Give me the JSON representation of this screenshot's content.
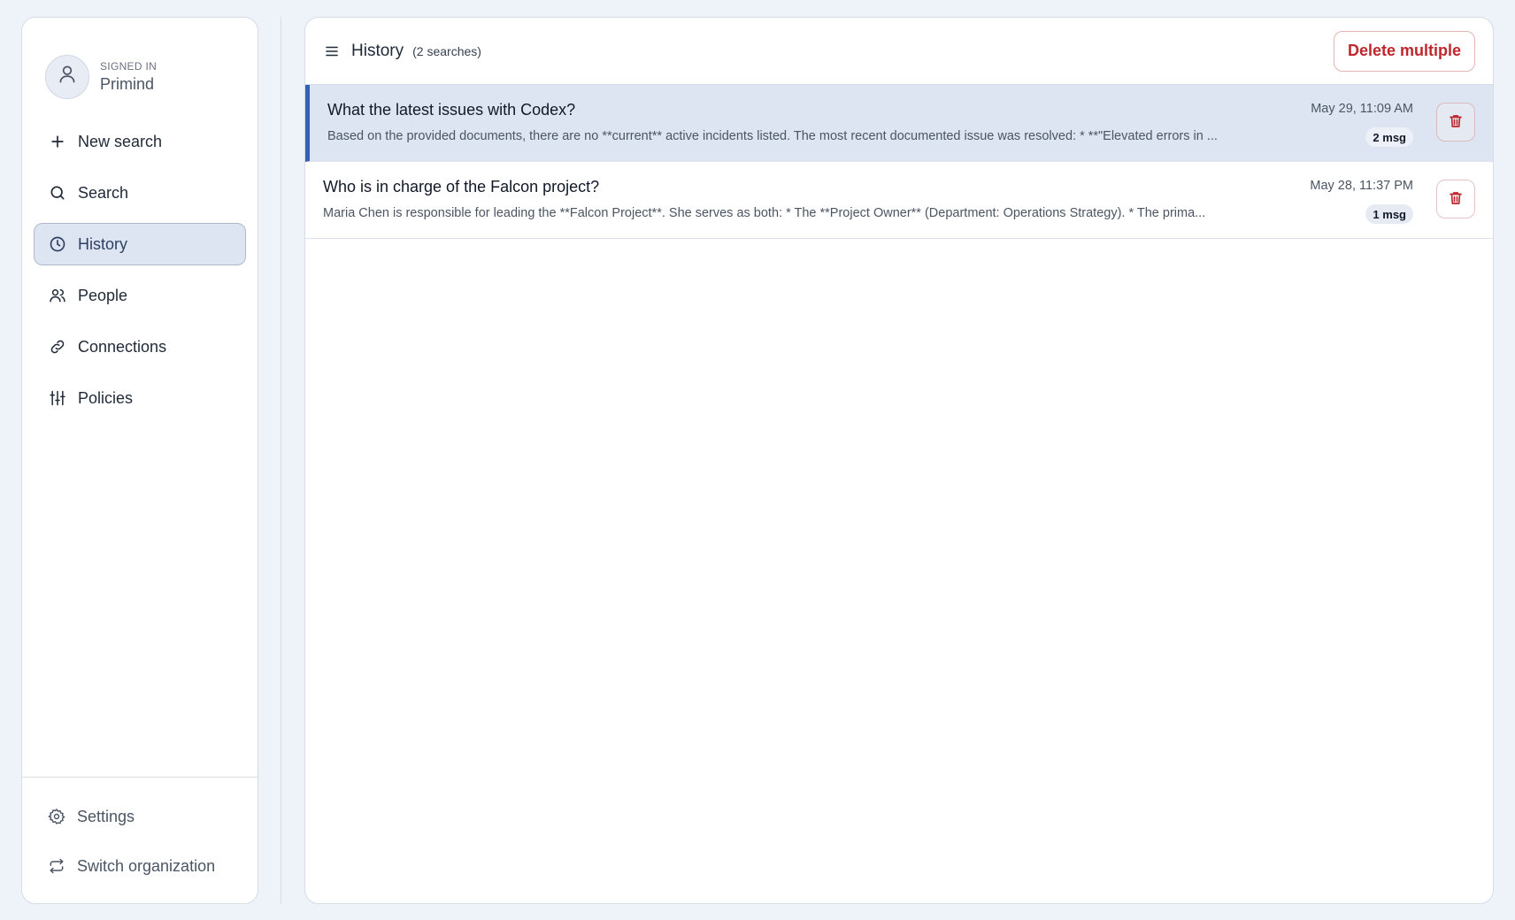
{
  "user": {
    "status": "SIGNED IN",
    "name": "Primind",
    "avatar_icon": "user-icon"
  },
  "sidebar": {
    "items": [
      {
        "label": "New search",
        "icon": "plus-icon",
        "active": false
      },
      {
        "label": "Search",
        "icon": "search-icon",
        "active": false
      },
      {
        "label": "History",
        "icon": "clock-icon",
        "active": true
      },
      {
        "label": "People",
        "icon": "people-icon",
        "active": false
      },
      {
        "label": "Connections",
        "icon": "link-icon",
        "active": false
      },
      {
        "label": "Policies",
        "icon": "sliders-icon",
        "active": false
      }
    ],
    "bottom": [
      {
        "label": "Settings",
        "icon": "gear-icon"
      },
      {
        "label": "Switch organization",
        "icon": "switch-icon"
      }
    ]
  },
  "header": {
    "title": "History",
    "count": "(2 searches)",
    "delete_multiple_label": "Delete multiple"
  },
  "history": [
    {
      "title": "What the latest issues with Codex?",
      "snippet": "Based on the provided documents, there are no **current** active incidents listed. The most recent documented issue was resolved: * **\"Elevated errors in ...",
      "date": "May 29, 11:09 AM",
      "badge": "2 msg",
      "selected": true
    },
    {
      "title": "Who is in charge of the Falcon project?",
      "snippet": "Maria Chen is responsible for leading the **Falcon Project**. She serves as both: * The **Project Owner** (Department: Operations Strategy). * The prima...",
      "date": "May 28, 11:37 PM",
      "badge": "1 msg",
      "selected": false
    }
  ],
  "colors": {
    "background": "#eef3fa",
    "accent": "#2f62b8",
    "active_bg": "#dde5f2",
    "danger": "#c0262d"
  }
}
